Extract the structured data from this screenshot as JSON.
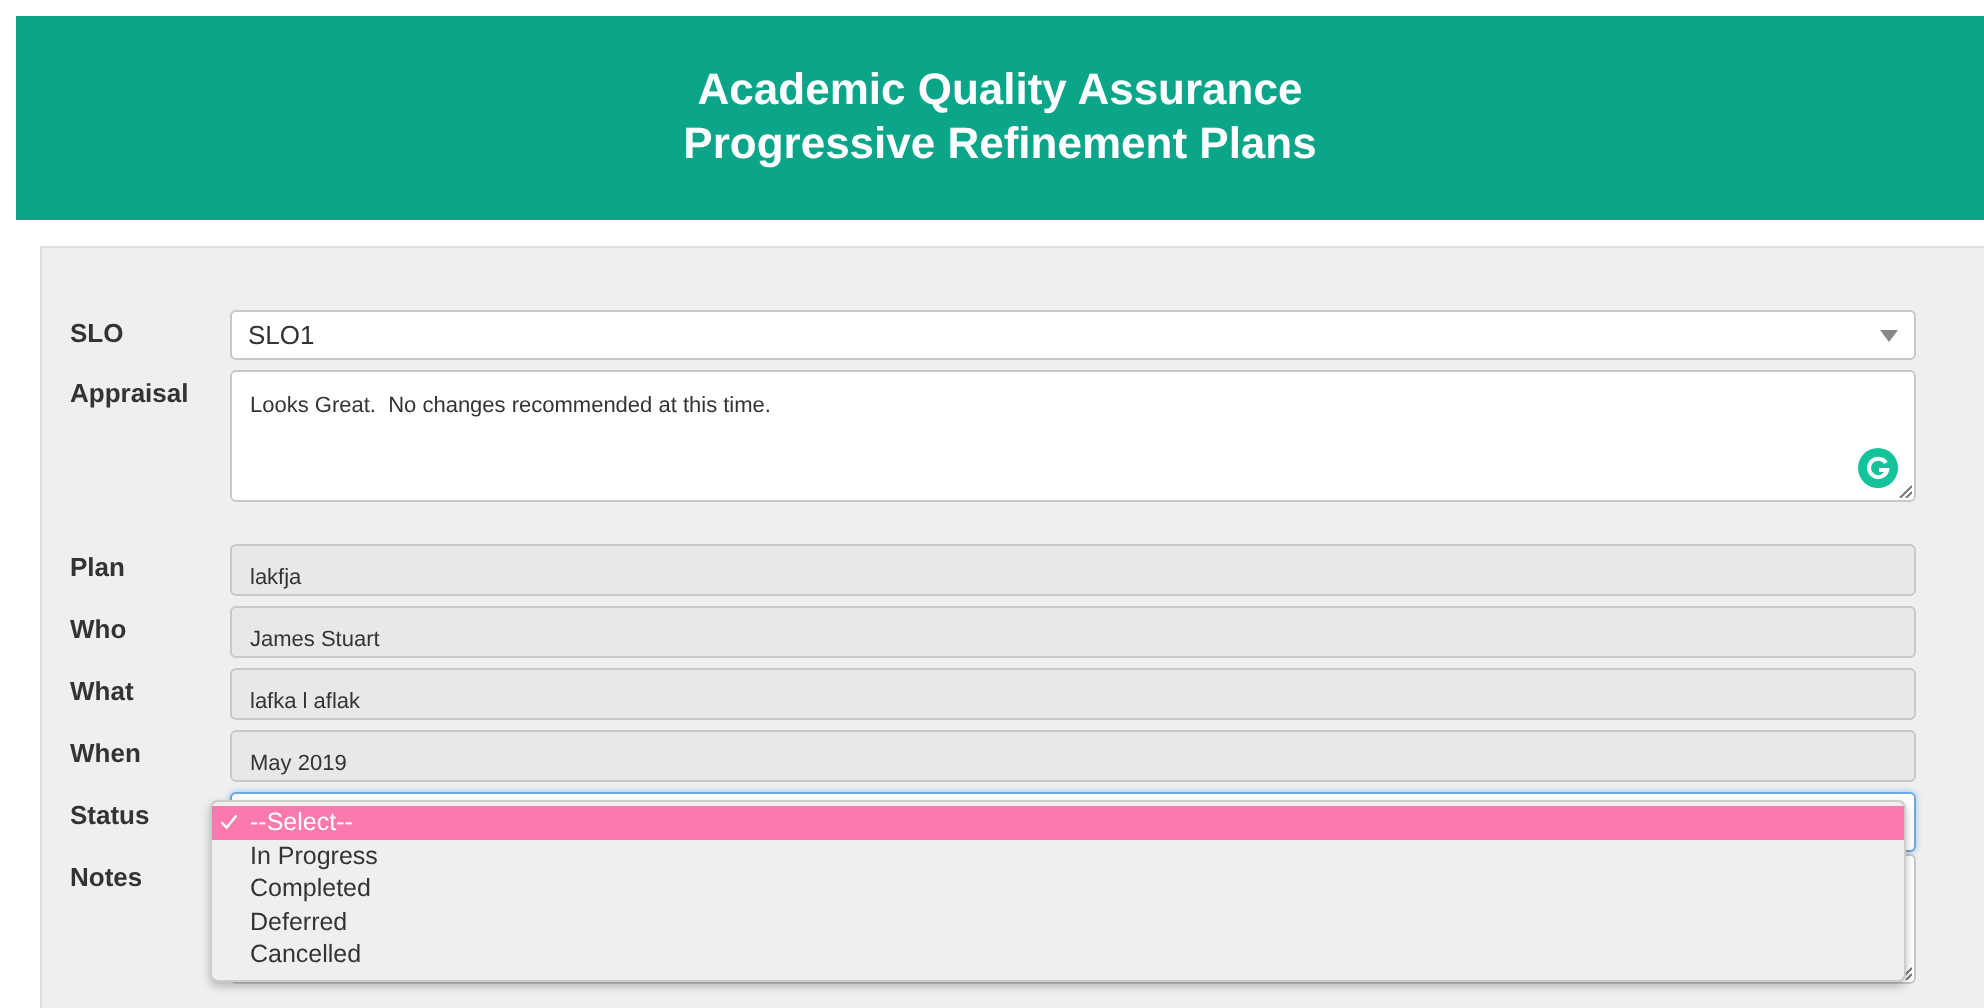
{
  "header": {
    "title_lines": [
      "Academic Quality Assurance",
      "Progressive Refinement Plans"
    ]
  },
  "form": {
    "fields": [
      {
        "kind": "select",
        "label": "SLO",
        "value": "SLO1"
      },
      {
        "kind": "textarea",
        "label": "Appraisal",
        "value": "Looks Great.  No changes recommended at this time."
      },
      {
        "kind": "readonly",
        "label": "Plan",
        "value": "lakfja"
      },
      {
        "kind": "readonly",
        "label": "Who",
        "value": "James Stuart"
      },
      {
        "kind": "readonly",
        "label": "What",
        "value": "lafka l aflak"
      },
      {
        "kind": "readonly",
        "label": "When",
        "value": "May 2019"
      },
      {
        "kind": "status",
        "label": "Status",
        "options": [
          {
            "label": "--Select--",
            "selected": true
          },
          {
            "label": "In Progress",
            "selected": false
          },
          {
            "label": "Completed",
            "selected": false
          },
          {
            "label": "Deferred",
            "selected": false
          },
          {
            "label": "Cancelled",
            "selected": false
          }
        ]
      },
      {
        "kind": "notes",
        "label": "Notes"
      }
    ]
  }
}
